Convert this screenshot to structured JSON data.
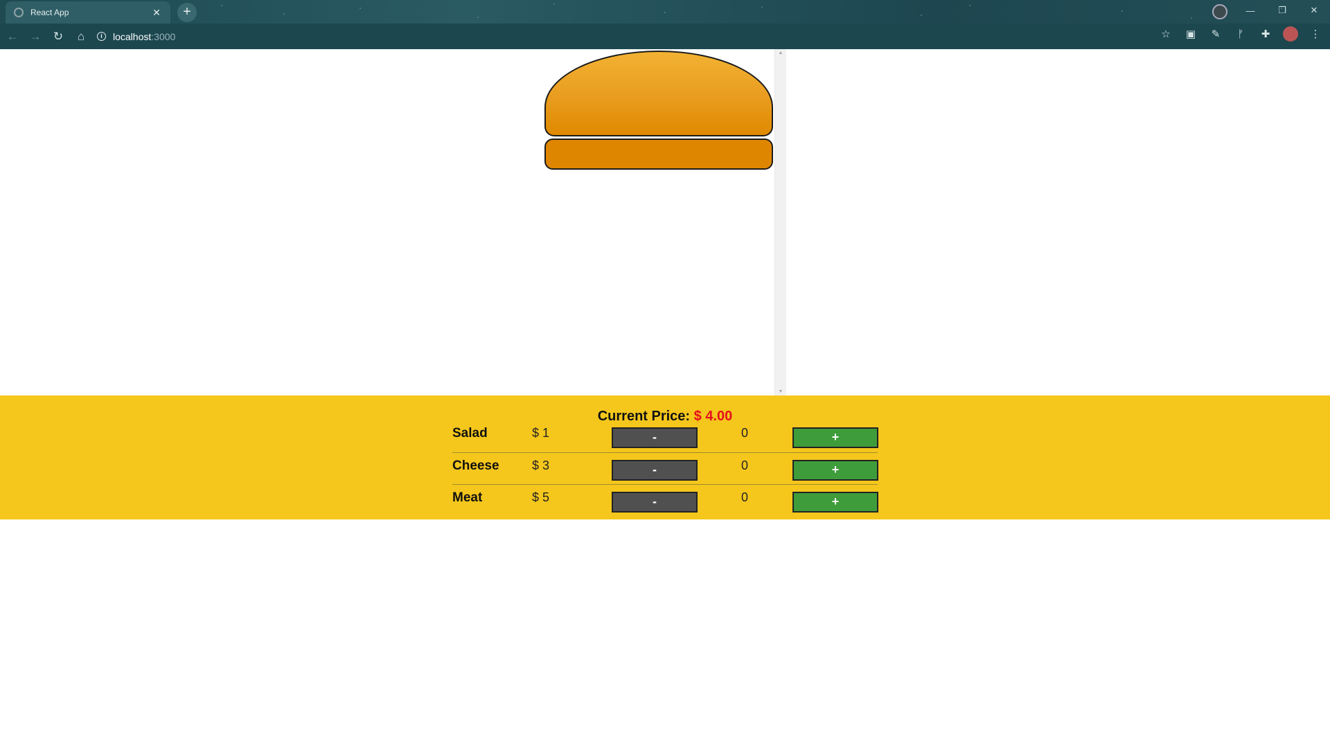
{
  "browser": {
    "tab_title": "React App",
    "url_host": "localhost",
    "url_port": ":3000"
  },
  "builder": {
    "price_label": "Current Price:",
    "price_value": "$ 4.00",
    "ingredients": [
      {
        "name": "Salad",
        "price": "$ 1",
        "count": "0",
        "minus": "-",
        "plus": "+"
      },
      {
        "name": "Cheese",
        "price": "$ 3",
        "count": "0",
        "minus": "-",
        "plus": "+"
      },
      {
        "name": "Meat",
        "price": "$ 5",
        "count": "0",
        "minus": "-",
        "plus": "+"
      }
    ]
  },
  "colors": {
    "controls_bg": "#f5c71c",
    "price_accent": "#e5101b",
    "less_button": "#505050",
    "more_button": "#3f9c3a",
    "bread": "#df8600"
  }
}
